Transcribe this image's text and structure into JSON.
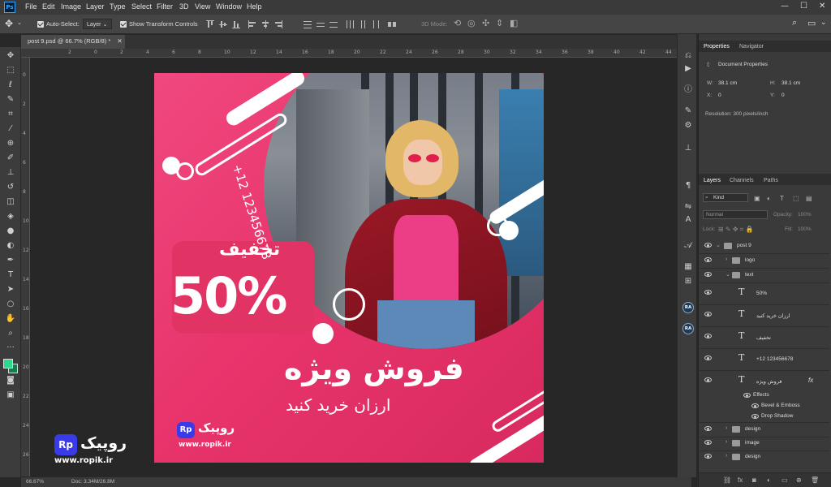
{
  "menubar": {
    "app_icon": "Ps",
    "items": [
      "File",
      "Edit",
      "Image",
      "Layer",
      "Type",
      "Select",
      "Filter",
      "3D",
      "View",
      "Window",
      "Help"
    ],
    "window_controls": [
      "minimize-icon",
      "maximize-icon",
      "close-icon"
    ]
  },
  "options": {
    "auto_select_label": "Auto-Select:",
    "auto_select_value": "Layer",
    "transform_label": "Show Transform Controls",
    "mode_3d": "3D Mode:"
  },
  "document": {
    "tab_title": "post 9.psd @ 66.7% (RGB/8) *",
    "zoom": "66.67%",
    "doc_size": "Doc: 3.34M/26.8M"
  },
  "rulers": {
    "top": [
      "2",
      "0",
      "2",
      "4",
      "6",
      "8",
      "10",
      "12",
      "14",
      "16",
      "18",
      "20",
      "22",
      "24",
      "26",
      "28",
      "30",
      "32",
      "34",
      "36",
      "38",
      "40",
      "42",
      "44"
    ],
    "left": [
      "0",
      "2",
      "4",
      "6",
      "8",
      "10",
      "12",
      "14",
      "16",
      "18",
      "20",
      "22",
      "24",
      "26"
    ]
  },
  "artwork": {
    "phone": "+12 123456678",
    "discount_word": "تخفیف",
    "percent": "50%",
    "headline": "فروش ویژه",
    "subline": "ارزان خرید کنید",
    "logo_text": "روپیک",
    "logo_badge": "Rp",
    "website": "www.ropik.ir",
    "colors": {
      "background": "#e8356c",
      "accent_box": "#e13464",
      "logo": "#3a3ae8"
    }
  },
  "watermark": {
    "badge": "Rp",
    "text": "روپیک",
    "url": "www.ropik.ir"
  },
  "properties": {
    "tabs": [
      "Properties",
      "Navigator"
    ],
    "title": "Document Properties",
    "w_label": "W:",
    "w_value": "38.1 cm",
    "h_label": "H:",
    "h_value": "38.1 cm",
    "x_label": "X:",
    "x_value": "0",
    "y_label": "Y:",
    "y_value": "0",
    "resolution": "Resolution: 300 pixels/inch"
  },
  "layers_panel": {
    "tabs": [
      "Layers",
      "Channels",
      "Paths"
    ],
    "kind_label": "Kind",
    "blend_mode": "Normal",
    "opacity_label": "Opacity:",
    "opacity_value": "100%",
    "lock_label": "Lock:",
    "fill_label": "Fill:",
    "fill_value": "100%",
    "layers": [
      {
        "name": "post 9",
        "type": "group",
        "indent": 0,
        "expanded": true
      },
      {
        "name": "logo",
        "type": "group",
        "indent": 1,
        "expanded": false
      },
      {
        "name": "text",
        "type": "group",
        "indent": 1,
        "expanded": true
      },
      {
        "name": "50%",
        "type": "text",
        "indent": 2
      },
      {
        "name": "ارزان خرید کنید",
        "type": "text",
        "indent": 2
      },
      {
        "name": "تخفیف",
        "type": "text",
        "indent": 2
      },
      {
        "name": "+12 123456678",
        "type": "text",
        "indent": 2
      },
      {
        "name": "فروش ویژه",
        "type": "text",
        "indent": 2,
        "fx": "fx"
      },
      {
        "name": "Effects",
        "type": "effect",
        "indent": 3
      },
      {
        "name": "Bevel & Emboss",
        "type": "effect",
        "indent": 4
      },
      {
        "name": "Drop Shadow",
        "type": "effect",
        "indent": 4
      },
      {
        "name": "design",
        "type": "group",
        "indent": 1,
        "expanded": false
      },
      {
        "name": "image",
        "type": "group",
        "indent": 1,
        "expanded": false
      },
      {
        "name": "design",
        "type": "group",
        "indent": 1,
        "expanded": false
      }
    ]
  },
  "right_strip": {
    "ra1": "RA",
    "ra2": "RA"
  },
  "foreground_color": "#2ad98a",
  "background_color": "#1a7a50"
}
